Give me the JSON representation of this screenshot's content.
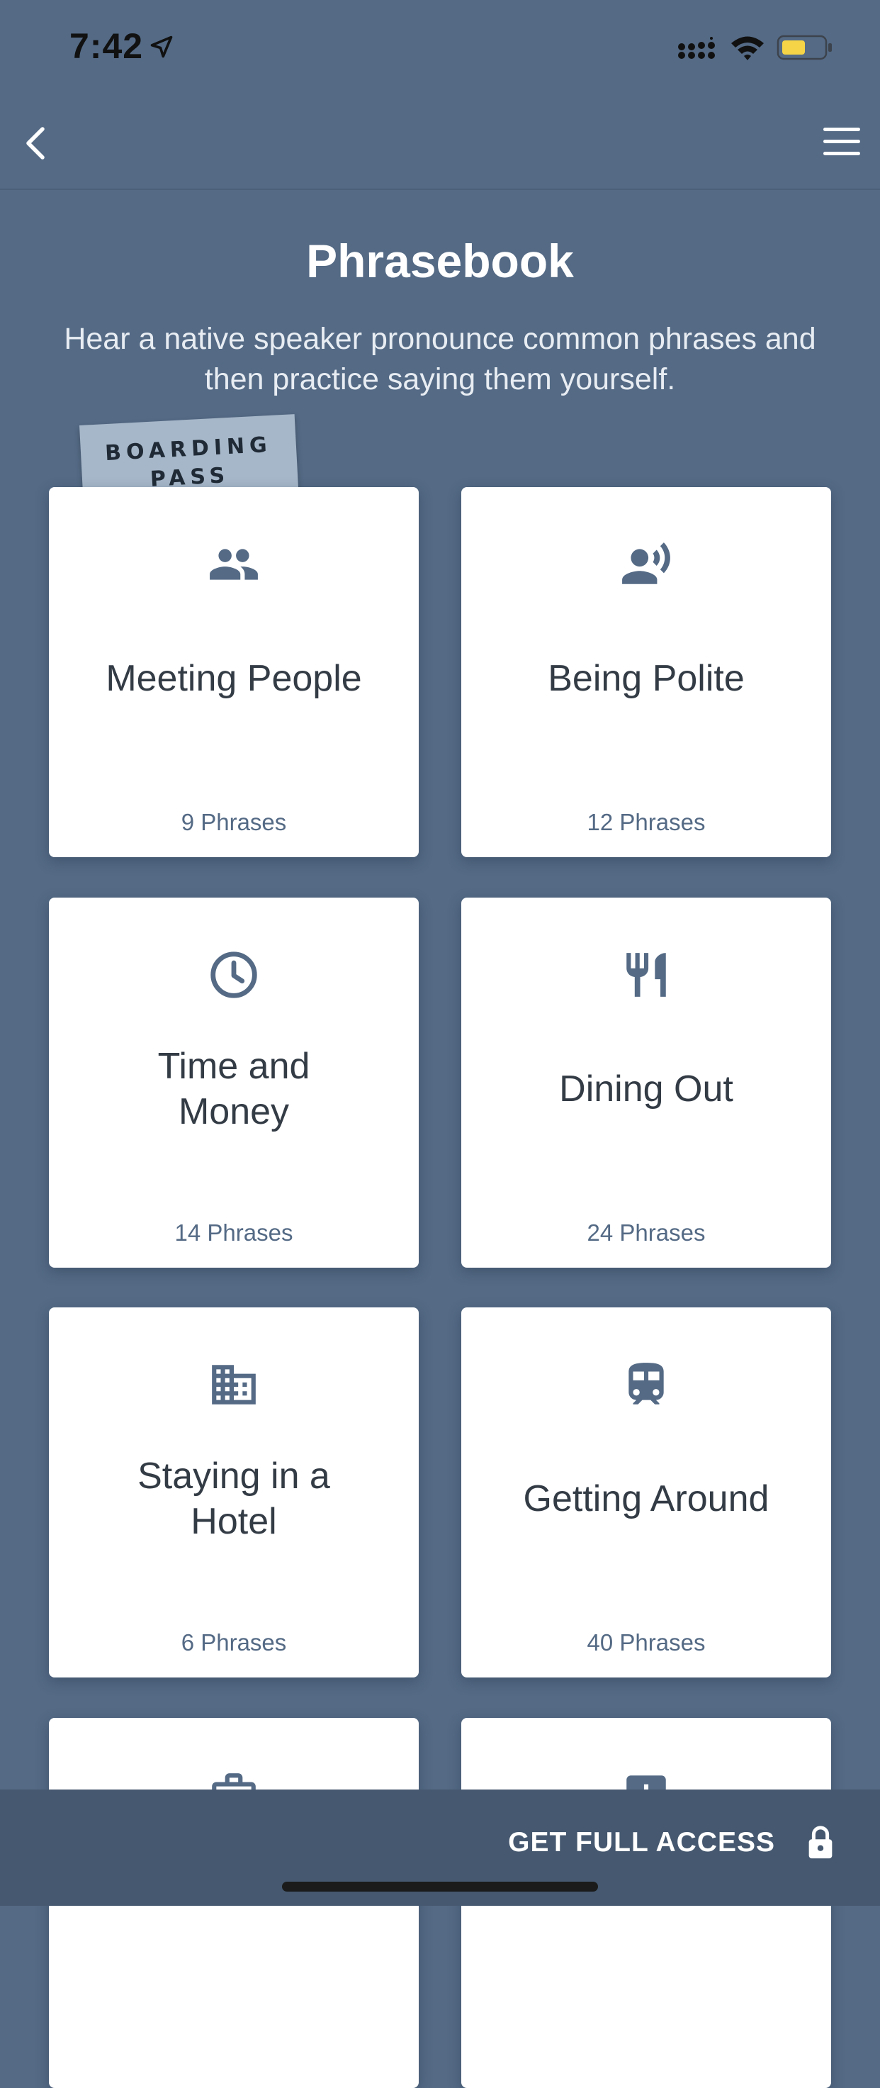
{
  "status_bar": {
    "time": "7:42",
    "battery_color": "#f5d547"
  },
  "nav": {
    "back_icon": "chevron-left-icon",
    "menu_icon": "hamburger-menu-icon"
  },
  "header": {
    "title": "Phrasebook",
    "subtitle": "Hear a native speaker pronounce common phrases and then practice saying them yourself."
  },
  "badge": {
    "label": "BOARDING\nPASS"
  },
  "categories": [
    {
      "title": "Meeting People",
      "count": "9 Phrases",
      "icon": "people-icon"
    },
    {
      "title": "Being Polite",
      "count": "12 Phrases",
      "icon": "speaking-person-icon"
    },
    {
      "title": "Time and Money",
      "count": "14 Phrases",
      "icon": "clock-icon"
    },
    {
      "title": "Dining Out",
      "count": "24 Phrases",
      "icon": "fork-knife-icon"
    },
    {
      "title": "Staying in a Hotel",
      "count": "6 Phrases",
      "icon": "building-icon"
    },
    {
      "title": "Getting Around",
      "count": "40 Phrases",
      "icon": "train-icon"
    },
    {
      "title": "",
      "count": "",
      "icon": "briefcase-icon"
    },
    {
      "title": "",
      "count": "",
      "icon": "medical-cross-icon"
    }
  ],
  "footer": {
    "cta_label": "GET FULL ACCESS",
    "cta_icon": "lock-icon"
  },
  "colors": {
    "background": "#546a85",
    "footer": "#45586f",
    "card": "#ffffff",
    "icon": "#546a85",
    "card_title": "#333b45"
  }
}
